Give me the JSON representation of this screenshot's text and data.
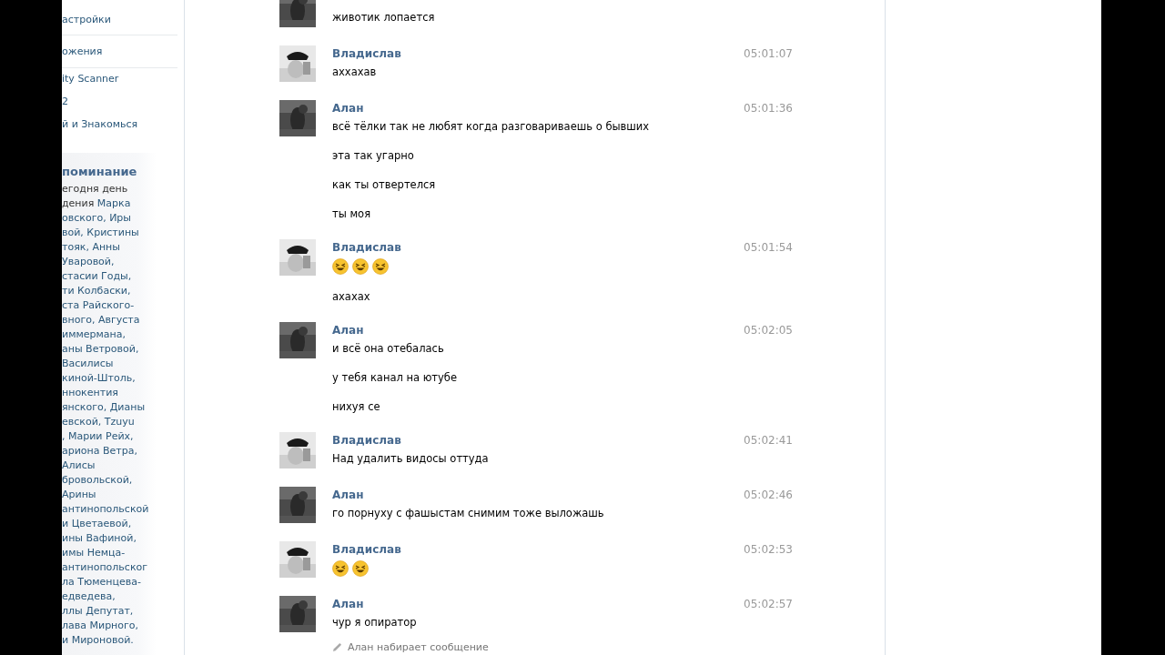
{
  "sidebar": {
    "menu": [
      "астройки",
      "ожения",
      "ity Scanner",
      "2",
      "й и Знакомься"
    ],
    "reminder": {
      "title": "поминание",
      "lines": [
        [
          {
            "text": "егодня день",
            "link": false
          }
        ],
        [
          {
            "text": "дения ",
            "link": false
          },
          {
            "text": "Марка",
            "link": true
          }
        ],
        [
          {
            "text": "овского, Иры",
            "link": true
          }
        ],
        [
          {
            "text": "вой, Кристины",
            "link": true
          }
        ],
        [
          {
            "text": "тояк, Анны",
            "link": true
          }
        ],
        [
          {
            "text": "Уваровой,",
            "link": true
          }
        ],
        [
          {
            "text": "стасии Годы,",
            "link": true
          }
        ],
        [
          {
            "text": "ти Колбаски,",
            "link": true
          }
        ],
        [
          {
            "text": "ста Райского-",
            "link": true
          }
        ],
        [
          {
            "text": "вного, Августа",
            "link": true
          }
        ],
        [
          {
            "text": "иммермана,",
            "link": true
          }
        ],
        [
          {
            "text": "аны Ветровой,",
            "link": true
          }
        ],
        [
          {
            "text": "Василисы",
            "link": true
          }
        ],
        [
          {
            "text": "киной-Штоль,",
            "link": true
          }
        ],
        [
          {
            "text": "ннокентия",
            "link": true
          }
        ],
        [
          {
            "text": "янского, Дианы",
            "link": true
          }
        ],
        [
          {
            "text": "евской, Tzuyu",
            "link": true
          }
        ],
        [
          {
            "text": ", Марии Рейх,",
            "link": true
          }
        ],
        [
          {
            "text": "ариона Ветра,",
            "link": true
          }
        ],
        [
          {
            "text": "Алисы",
            "link": true
          }
        ],
        [
          {
            "text": "бровольской,",
            "link": true
          }
        ],
        [
          {
            "text": "Арины",
            "link": true
          }
        ],
        [
          {
            "text": "антинопольской",
            "link": true
          }
        ],
        [
          {
            "text": "и Цветаевой,",
            "link": true
          }
        ],
        [
          {
            "text": "ины Вафиной,",
            "link": true
          }
        ],
        [
          {
            "text": "имы Немца-",
            "link": true
          }
        ],
        [
          {
            "text": "антинопольског",
            "link": true
          }
        ],
        [
          {
            "text": "ла Тюменцева-",
            "link": true
          }
        ],
        [
          {
            "text": "едведева,",
            "link": true
          }
        ],
        [
          {
            "text": "ллы Депутат,",
            "link": true
          }
        ],
        [
          {
            "text": "лава Мирного,",
            "link": true
          }
        ],
        [
          {
            "text": "и Мироновой.",
            "link": true
          }
        ]
      ]
    }
  },
  "messages": [
    {
      "lines": [
        {
          "kind": "text",
          "text": "животик лопается"
        }
      ]
    },
    {
      "name": "Владислав",
      "time": "05:01:07",
      "lines": [
        {
          "kind": "text",
          "text": "аххахав"
        }
      ]
    },
    {
      "name": "Алан",
      "time": "05:01:36",
      "lines": [
        {
          "kind": "text",
          "text": "всё тёлки так не любят когда разговариваешь о бывших"
        },
        {
          "kind": "text",
          "text": "эта так угарно"
        },
        {
          "kind": "text",
          "text": "как ты отвертелся"
        },
        {
          "kind": "text",
          "text": "ты моя"
        }
      ]
    },
    {
      "name": "Владислав",
      "time": "05:01:54",
      "lines": [
        {
          "kind": "emoji",
          "emoji": [
            {
              "kind": "laughing"
            },
            {
              "kind": "laughing"
            },
            {
              "kind": "laughing"
            }
          ]
        },
        {
          "kind": "text",
          "text": "ахахах"
        }
      ]
    },
    {
      "name": "Алан",
      "time": "05:02:05",
      "lines": [
        {
          "kind": "text",
          "text": "и всё она отебалась"
        },
        {
          "kind": "text",
          "text": "у тебя канал на ютубе"
        },
        {
          "kind": "text",
          "text": "нихуя се"
        }
      ]
    },
    {
      "name": "Владислав",
      "time": "05:02:41",
      "lines": [
        {
          "kind": "text",
          "text": "Над удалить видосы оттуда"
        }
      ]
    },
    {
      "name": "Алан",
      "time": "05:02:46",
      "lines": [
        {
          "kind": "text",
          "text": "го порнуху с фашыстам снимим тоже выложашь"
        }
      ]
    },
    {
      "name": "Владислав",
      "time": "05:02:53",
      "lines": [
        {
          "kind": "emoji",
          "emoji": [
            {
              "kind": "laughing"
            },
            {
              "kind": "laughing"
            }
          ]
        }
      ]
    },
    {
      "name": "Алан",
      "time": "05:02:57",
      "lines": [
        {
          "kind": "text",
          "text": "чур я опиратор"
        }
      ]
    }
  ],
  "typing": "Алан набирает сообщение"
}
